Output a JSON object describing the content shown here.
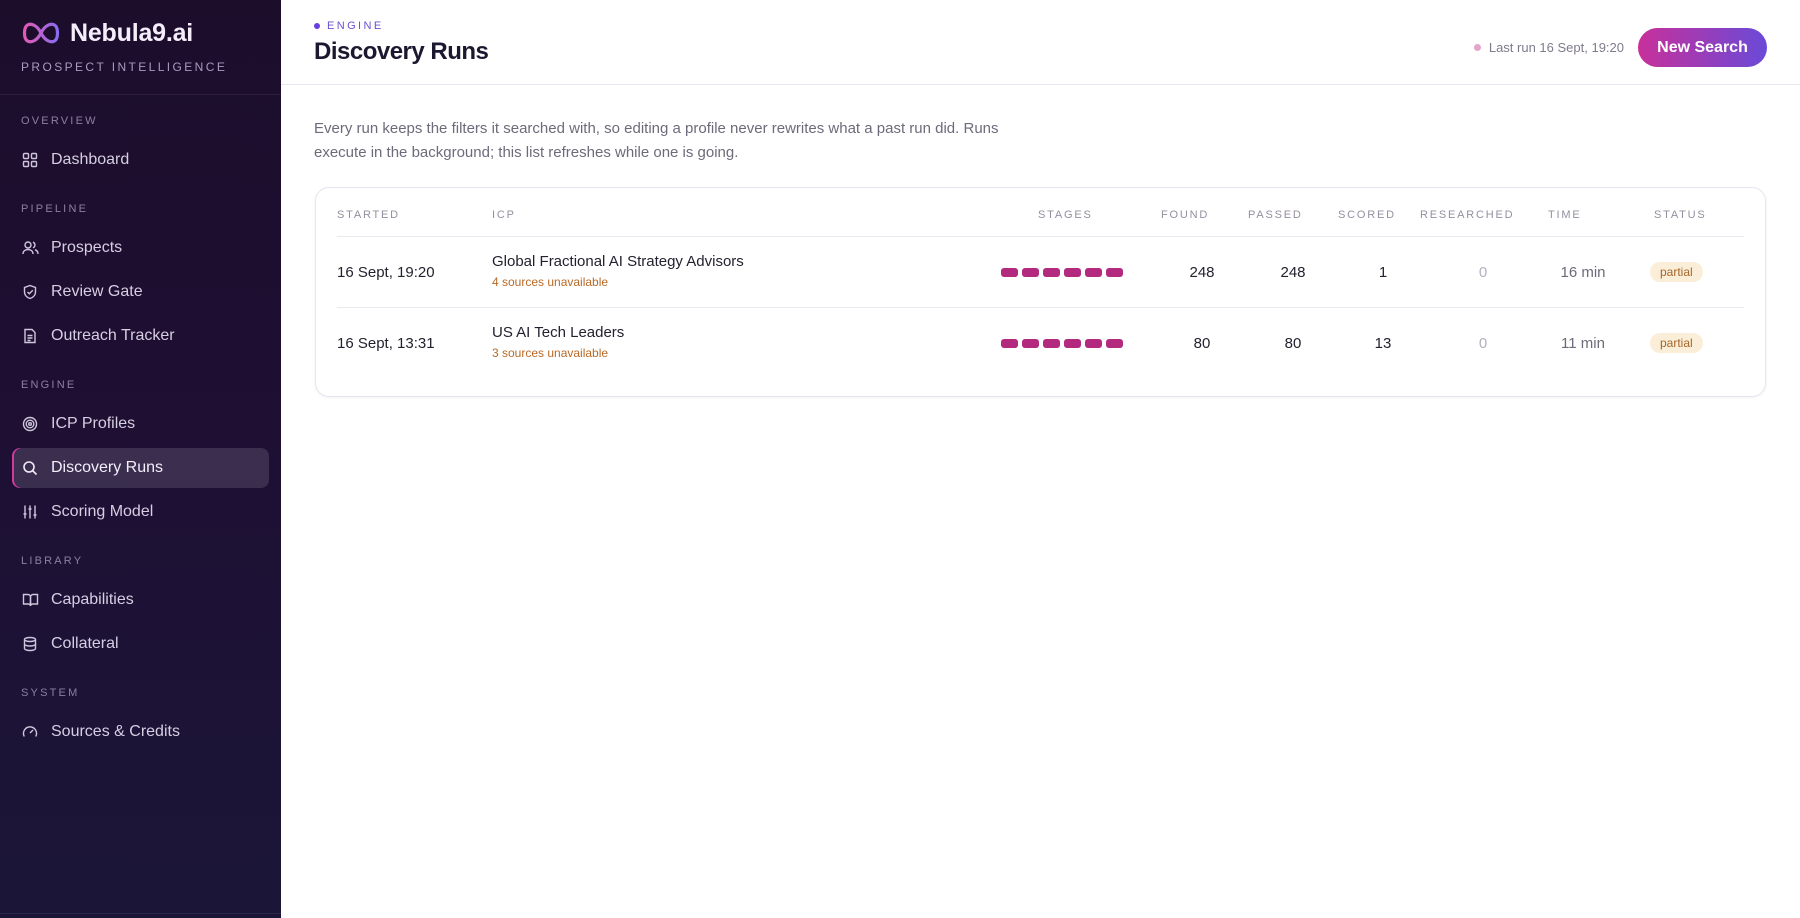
{
  "brand": {
    "name": "Nebula9.ai",
    "tagline": "PROSPECT INTELLIGENCE",
    "logo_icon": "infinity-logo",
    "accent_pink": "#d23aa0",
    "accent_violet": "#6a4ad8"
  },
  "sidebar": {
    "sections": [
      {
        "label": "OVERVIEW",
        "items": [
          {
            "label": "Dashboard",
            "icon": "grid-icon"
          }
        ]
      },
      {
        "label": "PIPELINE",
        "items": [
          {
            "label": "Prospects",
            "icon": "users-icon"
          },
          {
            "label": "Review Gate",
            "icon": "shield-check-icon"
          },
          {
            "label": "Outreach Tracker",
            "icon": "document-icon"
          }
        ]
      },
      {
        "label": "ENGINE",
        "items": [
          {
            "label": "ICP Profiles",
            "icon": "target-icon"
          },
          {
            "label": "Discovery Runs",
            "icon": "search-icon",
            "active": true
          },
          {
            "label": "Scoring Model",
            "icon": "sliders-icon"
          }
        ]
      },
      {
        "label": "LIBRARY",
        "items": [
          {
            "label": "Capabilities",
            "icon": "book-icon"
          },
          {
            "label": "Collateral",
            "icon": "database-icon"
          }
        ]
      },
      {
        "label": "SYSTEM",
        "items": [
          {
            "label": "Sources & Credits",
            "icon": "gauge-icon"
          }
        ]
      }
    ]
  },
  "header": {
    "eyebrow": "ENGINE",
    "title": "Discovery Runs",
    "last_run": "Last run 16 Sept, 19:20",
    "new_search_label": "New Search"
  },
  "intro": "Every run keeps the filters it searched with, so editing a profile never rewrites what a past run did. Runs execute in the background; this list refreshes while one is going.",
  "table": {
    "columns": [
      "STARTED",
      "ICP",
      "STAGES",
      "FOUND",
      "PASSED",
      "SCORED",
      "RESEARCHED",
      "TIME",
      "STATUS"
    ],
    "rows": [
      {
        "started": "16 Sept, 19:20",
        "icp": "Global Fractional AI Strategy Advisors",
        "warning": "4 sources unavailable",
        "stages_complete": 6,
        "stages_total": 6,
        "found": "248",
        "passed": "248",
        "scored": "1",
        "researched": "0",
        "time": "16 min",
        "status": "partial"
      },
      {
        "started": "16 Sept, 13:31",
        "icp": "US AI Tech Leaders",
        "warning": "3 sources unavailable",
        "stages_complete": 6,
        "stages_total": 6,
        "found": "80",
        "passed": "80",
        "scored": "13",
        "researched": "0",
        "time": "11 min",
        "status": "partial"
      }
    ]
  }
}
